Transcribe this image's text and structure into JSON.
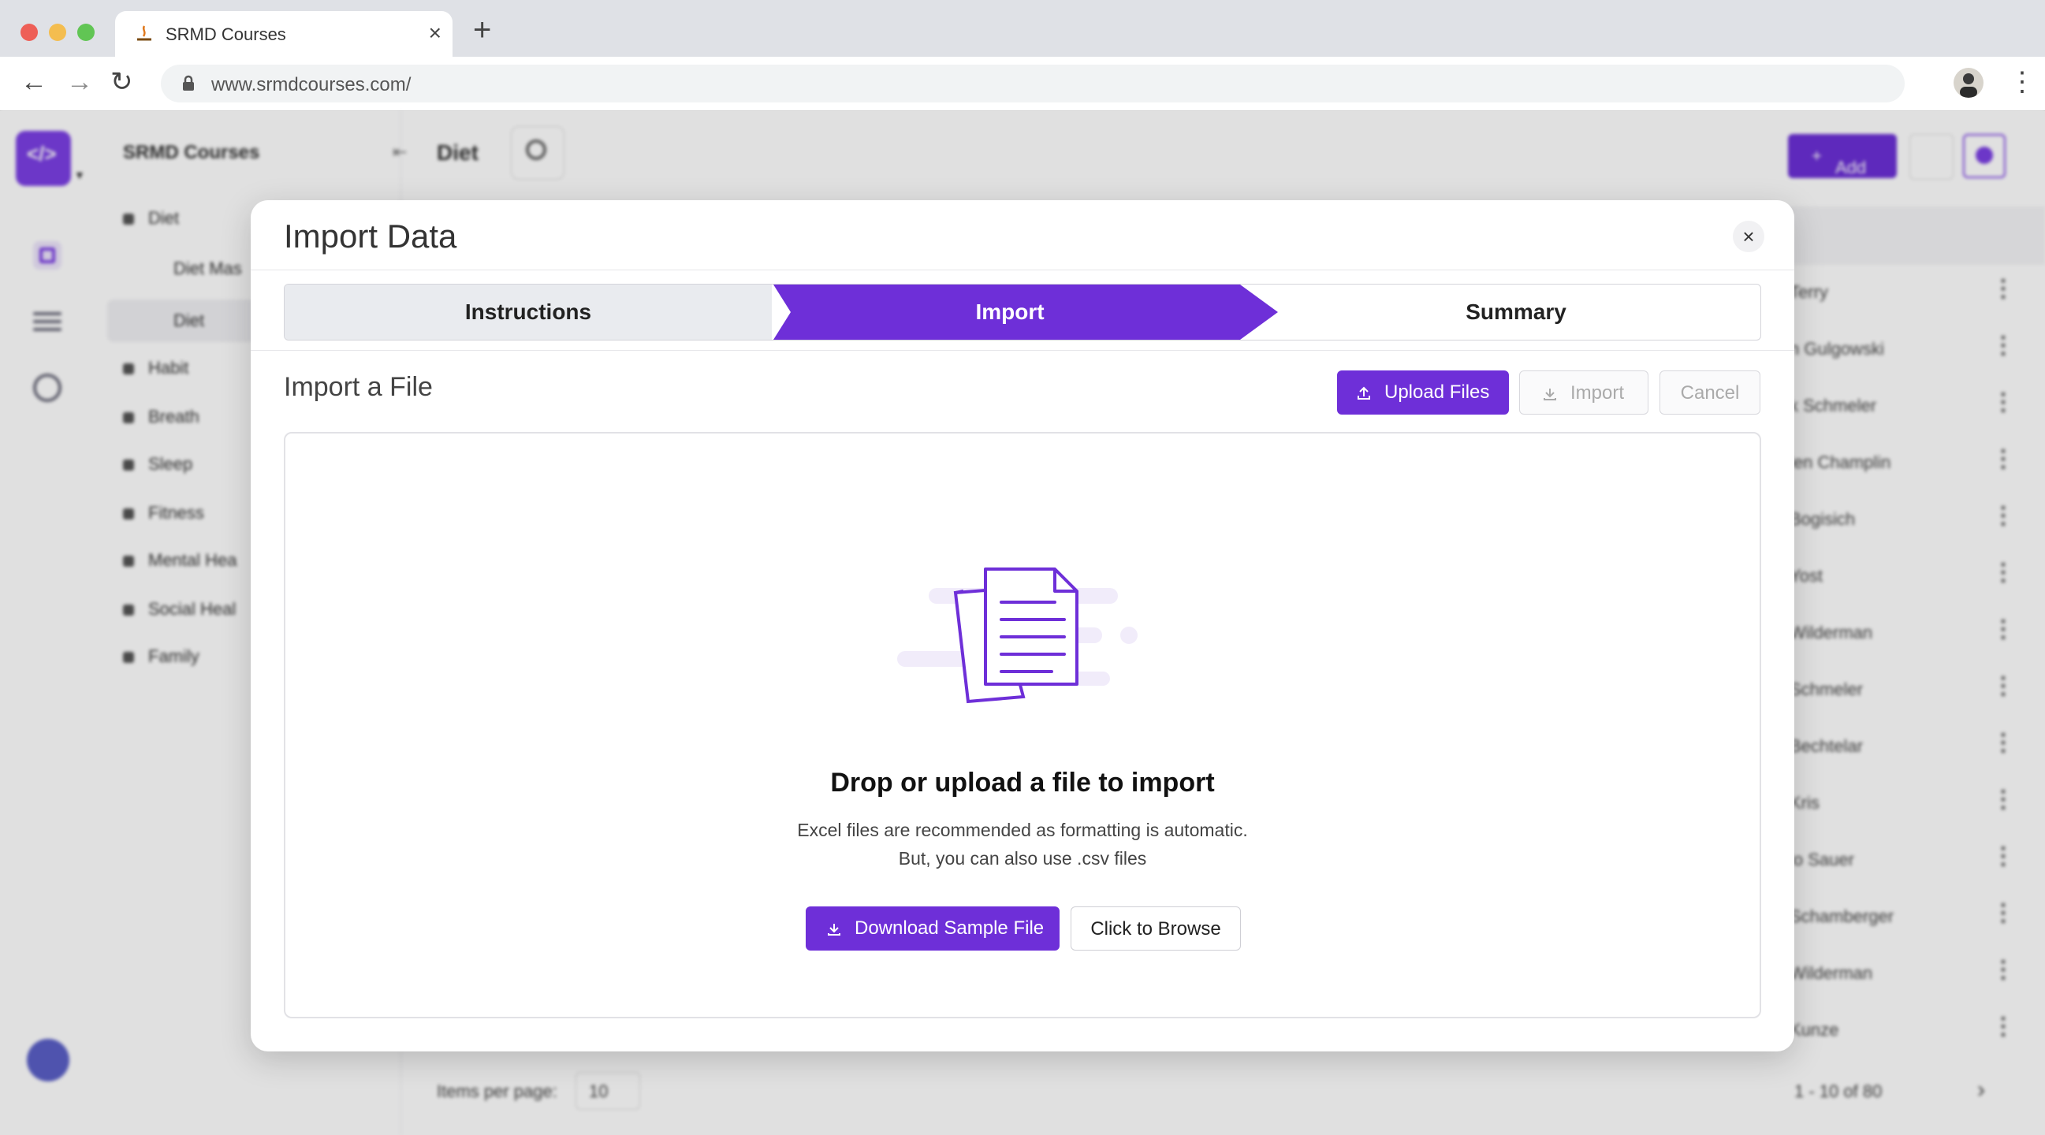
{
  "browser": {
    "tab_title": "SRMD Courses",
    "url": "www.srmdcourses.com/"
  },
  "app": {
    "sidebar_title": "SRMD Courses",
    "sidebar_items": [
      {
        "label": "Diet"
      },
      {
        "label": "Diet Mas"
      },
      {
        "label": "Diet"
      },
      {
        "label": "Habit"
      },
      {
        "label": "Breath"
      },
      {
        "label": "Sleep"
      },
      {
        "label": "Fitness"
      },
      {
        "label": "Mental Hea"
      },
      {
        "label": "Social Heal"
      },
      {
        "label": "Family"
      }
    ],
    "page_title": "Diet",
    "add_label": "Add",
    "rows": [
      "Terry",
      "n Gulgowski",
      "k Schmeler",
      "len Champlin",
      "Bogisich",
      "Yost",
      "Wilderman",
      "Schmeler",
      "Bechtelar",
      "Kris",
      "lo Sauer",
      "Schamberger",
      "Wilderman",
      "Kunze"
    ],
    "items_per_page_label": "Items per page:",
    "items_per_page_value": "10",
    "range": "1 - 10 of 80"
  },
  "modal": {
    "title": "Import Data",
    "steps": {
      "instructions": "Instructions",
      "import": "Import",
      "summary": "Summary"
    },
    "active_step": "Import",
    "section_title": "Import a File",
    "buttons": {
      "upload": "Upload Files",
      "import": "Import",
      "cancel": "Cancel",
      "download_sample": "Download Sample File",
      "browse": "Click to Browse"
    },
    "dropzone": {
      "title": "Drop or upload a file to import",
      "line1": "Excel files are recommended as formatting is automatic.",
      "line2": "But, you can also use .csv files"
    }
  },
  "colors": {
    "accent": "#6e2fd8",
    "step_inactive": "#e9ebef"
  }
}
